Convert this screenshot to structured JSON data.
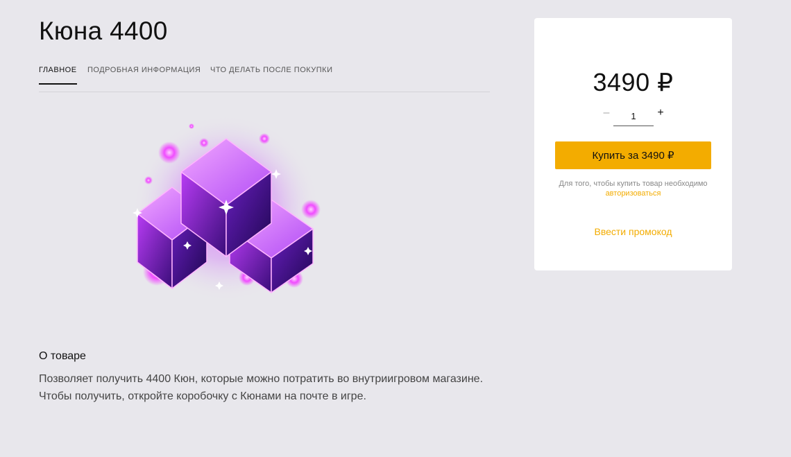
{
  "product": {
    "title": "Кюна 4400",
    "image_icon": "purple-crystals-icon"
  },
  "tabs": [
    {
      "label": "Главное",
      "active": true
    },
    {
      "label": "Подробная информация",
      "active": false
    },
    {
      "label": "Что делать после покупки",
      "active": false
    }
  ],
  "about": {
    "title": "О товаре",
    "text": "Позволяет получить 4400 Кюн, которые можно потратить во внутриигровом магазине. Чтобы получить, откройте коробочку с Кюнами на почте в игре."
  },
  "purchase": {
    "price": "3490 ₽",
    "quantity": "1",
    "minus_label": "–",
    "plus_label": "+",
    "buy_label": "Купить за 3490 ₽",
    "auth_note_text": "Для того, чтобы купить товар необходимо",
    "auth_link_label": "авторизоваться",
    "promo_label": "Ввести промокод"
  },
  "colors": {
    "page_background": "#e8e7ec",
    "accent": "#f3ac00",
    "crystal": "#9b2ff0"
  }
}
